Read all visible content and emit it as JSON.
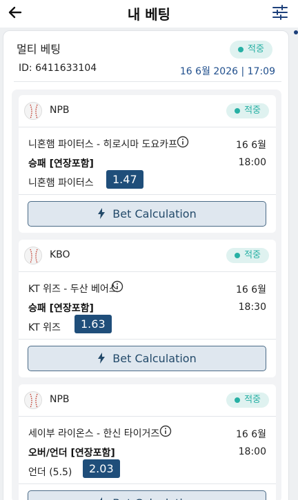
{
  "header": {
    "title": "내 베팅",
    "back_icon": "arrow-left-icon",
    "filter_icon": "sliders-icon"
  },
  "colors": {
    "accent": "#1f4e7a",
    "won": "#27b0a4",
    "won_bg": "#dff2f0",
    "date": "#1f4e8c"
  },
  "bet": {
    "type": "멀티 베팅",
    "status": "적중",
    "id": "ID: 6411633104",
    "datetime": "16 6월 2026 | 17:09"
  },
  "legs": [
    {
      "league": "NPB",
      "status": "적중",
      "match": "니혼햄 파이터스 - 히로시마 도요카프",
      "date": "16 6월",
      "market": "승패 [연장포함]",
      "time": "18:00",
      "selection": "니혼햄 파이터스",
      "odds": "1.47",
      "calc_label": "Bet Calculation"
    },
    {
      "league": "KBO",
      "status": "적중",
      "match": "KT 위즈 - 두산 베어스",
      "date": "16 6월",
      "market": "승패 [연장포함]",
      "time": "18:30",
      "selection": "KT 위즈",
      "odds": "1.63",
      "calc_label": "Bet Calculation"
    },
    {
      "league": "NPB",
      "status": "적중",
      "match": "세이부 라이온스 - 한신 타이거즈",
      "date": "16 6월",
      "market": "오버/언더 [연장포함]",
      "time": "18:00",
      "selection": "언더 (5.5)",
      "odds": "2.03",
      "calc_label": "Bet Calculation"
    }
  ]
}
